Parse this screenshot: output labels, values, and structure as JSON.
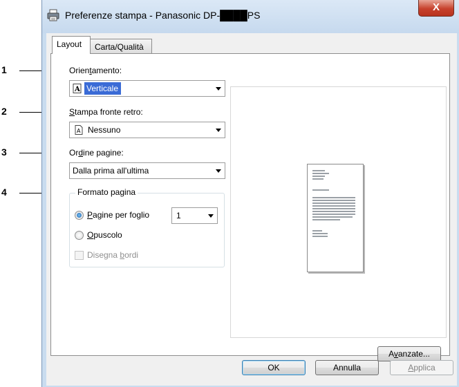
{
  "window": {
    "title": "Preferenze stampa - Panasonic DP-████PS",
    "title_icon": "printer-icon",
    "close_label": "X"
  },
  "tabs": [
    {
      "label": "Layout",
      "active": true
    },
    {
      "label": "Carta/Qualità",
      "active": false
    }
  ],
  "orientation": {
    "label_pre": "Orien",
    "label_u": "t",
    "label_post": "amento:",
    "value": "Verticale",
    "icon": "portrait-page-icon"
  },
  "duplex": {
    "label_u": "S",
    "label_post": "tampa fronte retro:",
    "value": "Nessuno",
    "icon": "single-page-icon"
  },
  "page_order": {
    "label_pre": "Or",
    "label_u": "d",
    "label_post": "ine pagine:",
    "value": "Dalla prima all'ultima"
  },
  "page_format": {
    "group_title": "Formato pagina",
    "pages_per_sheet_u": "P",
    "pages_per_sheet_post": "agine per foglio",
    "pages_per_sheet_value": "1",
    "booklet_u": "O",
    "booklet_post": "puscolo",
    "draw_borders_pre": "Disegna ",
    "draw_borders_u": "b",
    "draw_borders_post": "ordi",
    "selected": "pages_per_sheet"
  },
  "buttons": {
    "advanced_pre": "A",
    "advanced_u": "v",
    "advanced_post": "anzate...",
    "ok": "OK",
    "cancel": "Annulla",
    "apply_pre": "",
    "apply_u": "A",
    "apply_post": "pplica"
  },
  "callouts": [
    "1",
    "2",
    "3",
    "4"
  ],
  "colors": {
    "selection": "#3a6bd6",
    "close_button": "#c7412c",
    "frame": "#c9dcef"
  }
}
